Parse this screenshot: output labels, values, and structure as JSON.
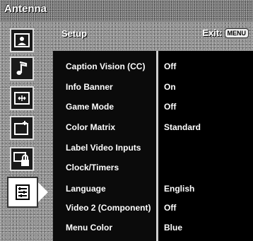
{
  "app": {
    "title": "Antenna"
  },
  "header": {
    "title": "Setup",
    "exit_label": "Exit:",
    "exit_key": "MENU"
  },
  "sidebar": {
    "items": [
      {
        "icon": "picture-icon"
      },
      {
        "icon": "music-note-icon"
      },
      {
        "icon": "screen-icon"
      },
      {
        "icon": "channel-icon"
      },
      {
        "icon": "lock-icon"
      },
      {
        "icon": "setup-list-icon",
        "selected": true
      }
    ]
  },
  "settings": [
    {
      "label": "Caption Vision (CC)",
      "value": "Off"
    },
    {
      "label": "Info Banner",
      "value": "On"
    },
    {
      "label": "Game Mode",
      "value": "Off"
    },
    {
      "label": "Color Matrix",
      "value": "Standard"
    },
    {
      "label": "Label Video Inputs",
      "value": ""
    },
    {
      "label": "Clock/Timers",
      "value": ""
    },
    {
      "label": "Language",
      "value": "English"
    },
    {
      "label": "Video 2 (Component)",
      "value": "Off"
    },
    {
      "label": "Menu Color",
      "value": "Blue"
    }
  ]
}
